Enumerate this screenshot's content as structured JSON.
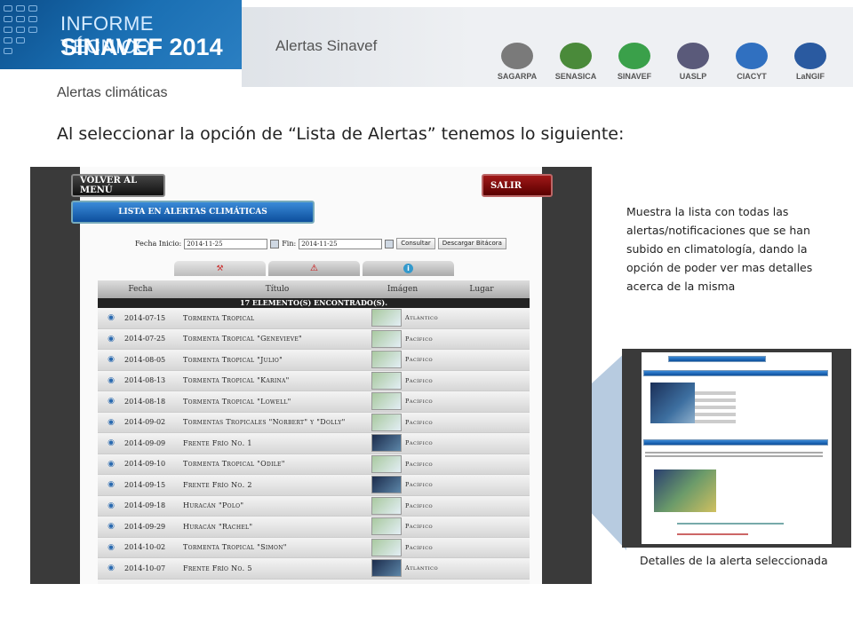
{
  "header": {
    "banner_line1": "INFORME TÉCNICO",
    "banner_line2": "SINAVEF 2014",
    "section_title": "Alertas Sinavef",
    "logos": [
      {
        "icon": "sagarpa-logo",
        "text": "SAGARPA",
        "color": "#7a7a7a"
      },
      {
        "icon": "senasica-logo",
        "text": "SENASICA",
        "color": "#4a8a3a"
      },
      {
        "icon": "sinavef-logo",
        "text": "SINAVEF",
        "color": "#3aa04a"
      },
      {
        "icon": "uaslp-logo",
        "text": "UASLP",
        "color": "#5a5a7a"
      },
      {
        "icon": "ciacyt-logo",
        "text": "CIACYT",
        "color": "#3070c0"
      },
      {
        "icon": "langif-logo",
        "text": "LaNGIF",
        "color": "#2a5aa0"
      }
    ]
  },
  "subtitle": "Alertas climáticas",
  "headline": "Al seleccionar la opción de “Lista de Alertas” tenemos lo siguiente:",
  "screenshot": {
    "volver_label": "Volver al menú",
    "salir_label": "Salir",
    "lista_label": "Lista en Alertas Climáticas",
    "fecha_inicio_label": "Fecha Inicio:",
    "fecha_inicio_value": "2014-11-25",
    "fin_label": "Fin:",
    "fin_value": "2014-11-25",
    "consultar_label": "Consultar",
    "descargar_label": "Descargar Bitácora",
    "columns": [
      "Fecha",
      "Título",
      "Imágen",
      "Lugar"
    ],
    "count_label": "17 elemento(s) encontrado(s).",
    "rows": [
      {
        "fecha": "2014-07-15",
        "titulo": "Tormenta Tropical",
        "lugar": "Atlántico",
        "dark": false
      },
      {
        "fecha": "2014-07-25",
        "titulo": "Tormenta Tropical \"Genevieve\"",
        "lugar": "Pacífico",
        "dark": false
      },
      {
        "fecha": "2014-08-05",
        "titulo": "Tormenta Tropical \"Julio\"",
        "lugar": "Pacífico",
        "dark": false
      },
      {
        "fecha": "2014-08-13",
        "titulo": "Tormenta Tropical \"Karina\"",
        "lugar": "Pacífico",
        "dark": false
      },
      {
        "fecha": "2014-08-18",
        "titulo": "Tormenta Tropical \"Lowell\"",
        "lugar": "Pacífico",
        "dark": false
      },
      {
        "fecha": "2014-09-02",
        "titulo": "Tormentas Tropicales \"Norbert\" y \"Dolly\"",
        "lugar": "Pacífico",
        "dark": false
      },
      {
        "fecha": "2014-09-09",
        "titulo": "Frente Frío No. 1",
        "lugar": "Pacífico",
        "dark": true
      },
      {
        "fecha": "2014-09-10",
        "titulo": "Tormenta Tropical \"Odile\"",
        "lugar": "Pacífico",
        "dark": false
      },
      {
        "fecha": "2014-09-15",
        "titulo": "Frente Frío No. 2",
        "lugar": "Pacífico",
        "dark": true
      },
      {
        "fecha": "2014-09-18",
        "titulo": "Huracán \"Polo\"",
        "lugar": "Pacífico",
        "dark": false
      },
      {
        "fecha": "2014-09-29",
        "titulo": "Huracán \"Rachel\"",
        "lugar": "Pacífico",
        "dark": false
      },
      {
        "fecha": "2014-10-02",
        "titulo": "Tormenta Tropical \"Simon\"",
        "lugar": "Pacífico",
        "dark": false
      },
      {
        "fecha": "2014-10-07",
        "titulo": "Frente Frío No. 5",
        "lugar": "Atlántico",
        "dark": true
      }
    ]
  },
  "description": "Muestra la lista con todas las alertas/notificaciones que se han subido en climatología, dando la opción de poder ver mas detalles acerca de la misma",
  "caption": "Detalles de la alerta seleccionada",
  "colors": {
    "accent_blue": "#0d4f9c",
    "salir_red": "#8a0c0c",
    "callout": "#b7cbe0"
  }
}
